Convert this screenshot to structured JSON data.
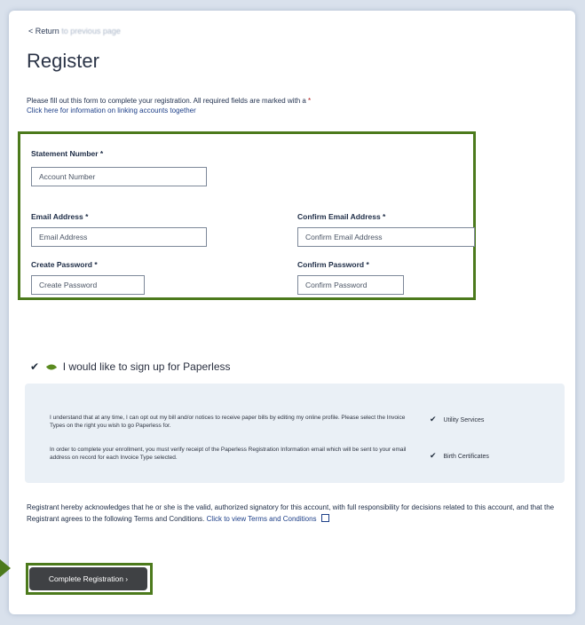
{
  "header": {
    "back_label": "< Return",
    "back_blurred": "to previous page",
    "title": "Register"
  },
  "intro": {
    "line1": "Please fill out this form to complete your registration. All required fields are marked with a",
    "required_mark": "*",
    "link_text": "Click here for information on linking accounts together"
  },
  "form": {
    "statement_label": "Statement Number *",
    "statement_placeholder": "Account Number",
    "email_label": "Email Address *",
    "email_placeholder": "Email Address",
    "confirm_email_label": "Confirm Email Address *",
    "confirm_email_placeholder": "Confirm Email Address",
    "password_label": "Create Password *",
    "password_placeholder": "Create Password",
    "confirm_password_label": "Confirm Password *",
    "confirm_password_placeholder": "Confirm Password"
  },
  "paperless": {
    "checkbox_label": "I would like to sign up for Paperless",
    "info1": "I understand that at any time, I can opt out my bill and/or notices to receive paper bills by editing my online profile. Please select the Invoice Types on the right you wish to go Paperless for.",
    "info2": "In order to complete your enrollment, you must verify receipt of the Paperless Registration Information email which will be sent to your email address on record for each Invoice Type selected.",
    "services": [
      "Utility Services",
      "Birth Certificates"
    ],
    "leaf_color": "#5a8a1f"
  },
  "acknowledgement": {
    "text": "Registrant hereby acknowledges that he or she is the valid, authorized signatory for this account, with full responsibility for decisions related to this account, and that the Registrant agrees to the following Terms and Conditions.",
    "link_text": "Click to view Terms and Conditions"
  },
  "actions": {
    "complete_label": "Complete Registration ›"
  },
  "colors": {
    "highlight_green": "#4c7a1c",
    "button_dark": "#3f4144",
    "link_blue": "#1d3f88"
  },
  "icons": {
    "back": "chevron-left-icon",
    "checkmark": "checkmark-icon",
    "leaf": "leaf-icon",
    "external_link": "external-link-icon"
  }
}
